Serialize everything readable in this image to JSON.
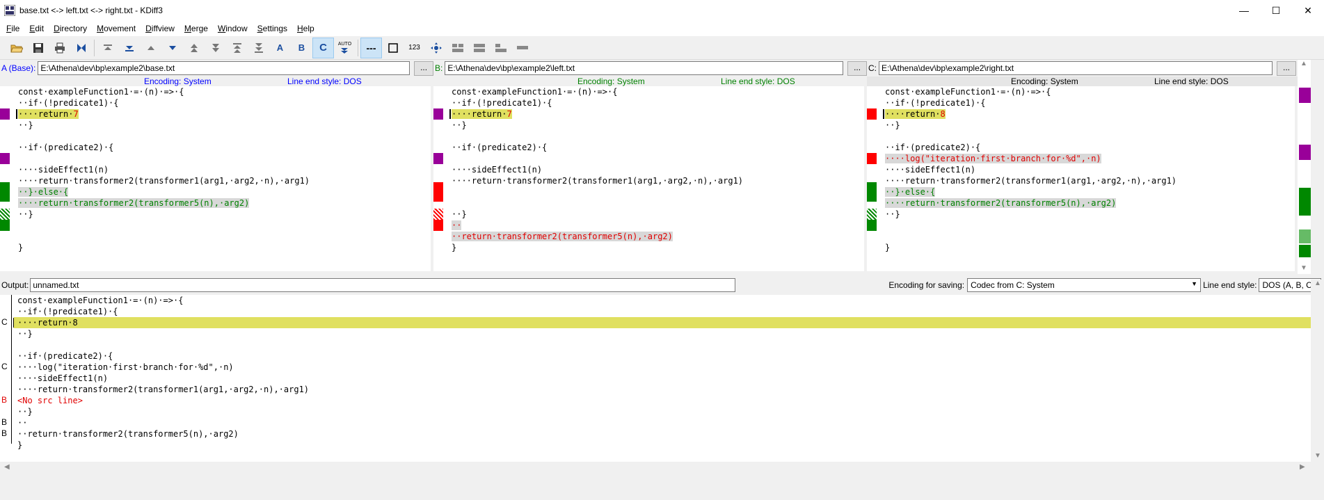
{
  "window": {
    "title": "base.txt <-> left.txt <-> right.txt - KDiff3"
  },
  "menu": [
    "File",
    "Edit",
    "Directory",
    "Movement",
    "Diffview",
    "Merge",
    "Window",
    "Settings",
    "Help"
  ],
  "toolbar_icons": [
    "open-icon",
    "save-icon",
    "print-icon",
    "goto-current-delta-icon",
    "goto-first-delta-icon",
    "goto-last-delta-icon",
    "goto-prev-delta-icon",
    "goto-next-delta-icon",
    "goto-prev-conflict-icon",
    "goto-next-conflict-icon",
    "goto-prev-unsolved-conflict-icon",
    "goto-next-unsolved-conflict-icon",
    "select-a-icon",
    "select-b-icon",
    "select-c-icon",
    "auto-advance-icon",
    "show-whitespace-icon",
    "show-whitespace-chars-icon",
    "show-line-numbers-icon",
    "choose-a-b-c-icon",
    "split-diff-icon",
    "join-diffs-icon",
    "show-window-a-icon",
    "overview-icon"
  ],
  "toolbar_labels": {
    "a": "A",
    "b": "B",
    "c": "C",
    "auto": "AUTO",
    "linenum": "123"
  },
  "panes": [
    {
      "label_prefix": "A",
      "label_suffix": " (Base):",
      "path": "E:\\Athena\\dev\\bp\\example2\\base.txt",
      "browse": "...",
      "encoding": "Encoding: System",
      "line_end": "Line end style: DOS",
      "lines": [
        "const·exampleFunction1·=·(n)·=>·{",
        "··if·(!predicate1)·{",
        "····return·",
        "··}",
        "",
        "··if·(predicate2)·{",
        "",
        "····sideEffect1(n)",
        "····return·transformer2(transformer1(arg1,·arg2,·n),·arg1)",
        "··}·else·{",
        "····return·transformer2(transformer5(n),·arg2)",
        "··}",
        "",
        "",
        "}"
      ],
      "line2_suffix": "7"
    },
    {
      "label_prefix": "B:",
      "label_suffix": "",
      "path": "E:\\Athena\\dev\\bp\\example2\\left.txt",
      "browse": "...",
      "encoding": "Encoding: System",
      "line_end": "Line end style: DOS",
      "lines": [
        "const·exampleFunction1·=·(n)·=>·{",
        "··if·(!predicate1)·{",
        "····return·",
        "··}",
        "",
        "··if·(predicate2)·{",
        "",
        "····sideEffect1(n)",
        "····return·transformer2(transformer1(arg1,·arg2,·n),·arg1)",
        "",
        "",
        "··}",
        "··",
        "··return·transformer2(transformer5(n),·arg2)",
        "}"
      ],
      "line2_suffix": "7"
    },
    {
      "label_prefix": "C:",
      "label_suffix": "",
      "path": "E:\\Athena\\dev\\bp\\example2\\right.txt",
      "browse": "...",
      "encoding": "Encoding: System",
      "line_end": "Line end style: DOS",
      "lines": [
        "const·exampleFunction1·=·(n)·=>·{",
        "··if·(!predicate1)·{",
        "····return·",
        "··}",
        "",
        "··if·(predicate2)·{",
        "····log(\"iteration·first·branch·for·%d\",·n)",
        "····sideEffect1(n)",
        "····return·transformer2(transformer1(arg1,·arg2,·n),·arg1)",
        "··}·else·{",
        "····return·transformer2(transformer5(n),·arg2)",
        "··}",
        "",
        "",
        "}"
      ],
      "line2_suffix": "8"
    }
  ],
  "output": {
    "label": "Output:",
    "filename": "unnamed.txt",
    "encoding_label": "Encoding for saving:",
    "encoding_value": "Codec from C: System",
    "line_end_label": "Line end style:",
    "line_end_value": "DOS (A, B, C)",
    "lines": [
      {
        "src": "",
        "text": "const·exampleFunction1·=·(n)·=>·{"
      },
      {
        "src": "",
        "text": "··if·(!predicate1)·{"
      },
      {
        "src": "C",
        "text": "····return·8"
      },
      {
        "src": "",
        "text": "··}"
      },
      {
        "src": "",
        "text": ""
      },
      {
        "src": "",
        "text": "··if·(predicate2)·{"
      },
      {
        "src": "C",
        "text": "····log(\"iteration·first·branch·for·%d\",·n)"
      },
      {
        "src": "",
        "text": "····sideEffect1(n)"
      },
      {
        "src": "",
        "text": "····return·transformer2(transformer1(arg1,·arg2,·n),·arg1)"
      },
      {
        "src": "B",
        "text": "<No src line>"
      },
      {
        "src": "",
        "text": "··}"
      },
      {
        "src": "B",
        "text": "··"
      },
      {
        "src": "B",
        "text": "··return·transformer2(transformer5(n),·arg2)"
      },
      {
        "src": "",
        "text": "}"
      }
    ]
  },
  "colors": {
    "accent_blue": "#0000ff",
    "base_label": "#0000ff",
    "b_label": "#008000",
    "conflict_red": "#ff0000",
    "change_purple": "#990099",
    "added_green": "#008800",
    "highlight_yellow": "#e0e060"
  }
}
